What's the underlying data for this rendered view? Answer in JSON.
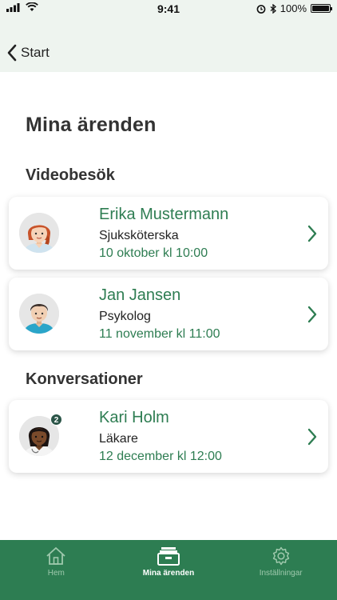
{
  "status_bar": {
    "time": "9:41",
    "battery": "100%",
    "battery_level": 1.0,
    "icons": [
      "signal-icon",
      "wifi-icon",
      "alarm-icon",
      "bluetooth-icon",
      "battery-icon"
    ]
  },
  "nav": {
    "back_label": "Start"
  },
  "page": {
    "title": "Mina ärenden"
  },
  "sections": {
    "video": {
      "title": "Videobesök",
      "items": [
        {
          "name": "Erika Mustermann",
          "role": "Sjuksköterska",
          "date": "10 oktober kl 10:00",
          "avatar": "nurse-avatar-icon"
        },
        {
          "name": "Jan Jansen",
          "role": "Psykolog",
          "date": "11 november kl 11:00",
          "avatar": "psychologist-avatar-icon"
        }
      ]
    },
    "conversations": {
      "title": "Konversationer",
      "items": [
        {
          "name": "Kari Holm",
          "role": "Läkare",
          "date": "12 december kl 12:00",
          "badge": "2",
          "avatar": "doctor-avatar-icon"
        }
      ]
    }
  },
  "tabs": [
    {
      "label": "Hem",
      "icon": "home-icon",
      "active": false
    },
    {
      "label": "Mina ärenden",
      "icon": "cases-icon",
      "active": true
    },
    {
      "label": "Inställningar",
      "icon": "settings-icon",
      "active": false
    }
  ],
  "colors": {
    "accent": "#2e7d52",
    "nav_bg": "#eef4ef",
    "tab_bar_bg": "#2d7d52",
    "badge_bg": "#2b5548"
  }
}
